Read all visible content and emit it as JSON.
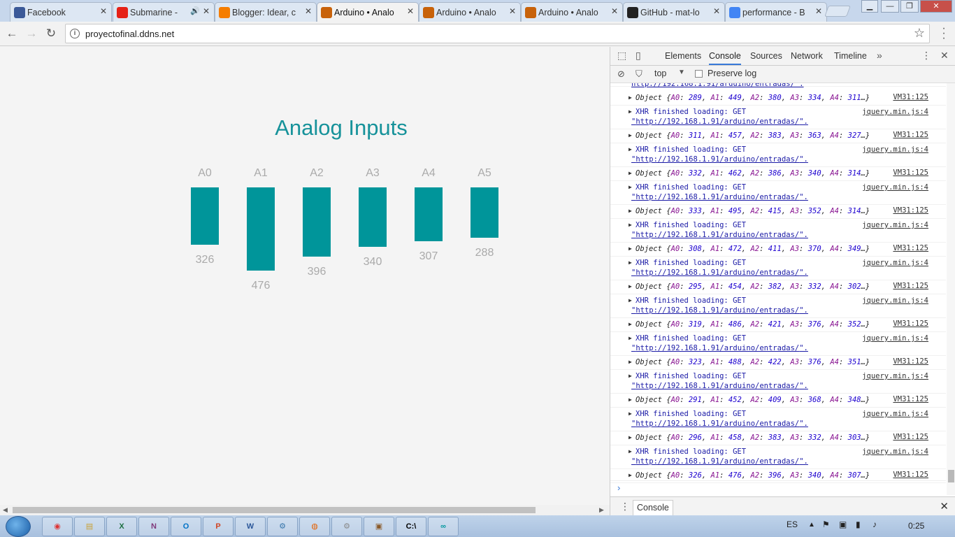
{
  "browser": {
    "tabs": [
      {
        "title": "Facebook",
        "favicon": "facebook-icon",
        "color": "#3b5998"
      },
      {
        "title": "Submarine -",
        "favicon": "youtube-icon",
        "color": "#e62117",
        "audio": true
      },
      {
        "title": "Blogger: Idear, c",
        "favicon": "blogger-icon",
        "color": "#f57d00"
      },
      {
        "title": "Arduino • Analo",
        "favicon": "arduino-icon",
        "color": "#c8620a",
        "active": true
      },
      {
        "title": "Arduino • Analo",
        "favicon": "arduino-icon",
        "color": "#c8620a"
      },
      {
        "title": "Arduino • Analo",
        "favicon": "arduino-icon",
        "color": "#c8620a"
      },
      {
        "title": "GitHub - mat-lo",
        "favicon": "github-icon",
        "color": "#222222"
      },
      {
        "title": "performance - B",
        "favicon": "google-icon",
        "color": "#4285f4"
      }
    ],
    "url": "proyectofinal.ddns.net"
  },
  "page": {
    "title": "Analog Inputs",
    "accent": "#00959a",
    "channels": [
      {
        "label": "A0",
        "value": "326"
      },
      {
        "label": "A1",
        "value": "476"
      },
      {
        "label": "A2",
        "value": "396"
      },
      {
        "label": "A3",
        "value": "340"
      },
      {
        "label": "A4",
        "value": "307"
      },
      {
        "label": "A5",
        "value": "288"
      }
    ]
  },
  "devtools": {
    "tabs": [
      "Elements",
      "Console",
      "Sources",
      "Network",
      "Timeline"
    ],
    "active_tab": "Console",
    "context": "top",
    "preserve_log": "Preserve log",
    "top_fragment": "http://192.168.1.91/arduino/entradas/\".",
    "xhr_text": "XHR finished loading: GET",
    "xhr_url": "http://192.168.1.91/arduino/entradas/",
    "xhr_source": "jquery.min.js:4",
    "obj_source": "VM31:125",
    "objects": [
      [
        289,
        449,
        380,
        334,
        311
      ],
      [
        311,
        457,
        383,
        363,
        327
      ],
      [
        332,
        462,
        386,
        340,
        314
      ],
      [
        333,
        495,
        415,
        352,
        314
      ],
      [
        308,
        472,
        411,
        370,
        349
      ],
      [
        295,
        454,
        382,
        332,
        302
      ],
      [
        319,
        486,
        421,
        376,
        352
      ],
      [
        323,
        488,
        422,
        376,
        351
      ],
      [
        291,
        452,
        409,
        368,
        348
      ],
      [
        296,
        458,
        383,
        332,
        303
      ],
      [
        326,
        476,
        396,
        340,
        307
      ]
    ],
    "drawer_tab": "Console"
  },
  "taskbar": {
    "apps": [
      "chrome-icon",
      "explorer-icon",
      "excel-icon",
      "onenote-icon",
      "outlook-icon",
      "powerpoint-icon",
      "word-icon",
      "python-icon",
      "firefox-icon",
      "settings-app-icon",
      "media-icon",
      "cmd-icon",
      "arduino-ide-icon"
    ],
    "language": "ES",
    "clock": "0:25"
  }
}
